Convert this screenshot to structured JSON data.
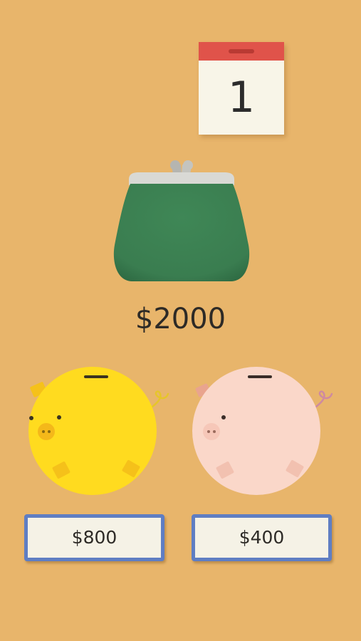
{
  "calendar": {
    "day": "1",
    "icon": "calendar-icon",
    "colors": {
      "header": "#e0534a",
      "page": "#f8f5e8"
    }
  },
  "wallet": {
    "icon": "coin-purse-icon",
    "amount": "$2000",
    "colors": {
      "body": "#3f8756",
      "clasp": "#d6d6d2"
    }
  },
  "piggy_banks": [
    {
      "icon": "yellow-piggy-bank-icon",
      "color": "#ffdb1f",
      "button_label": "$800"
    },
    {
      "icon": "pink-piggy-bank-icon",
      "color": "#fad7c9",
      "button_label": "$400"
    }
  ],
  "colors": {
    "background": "#e8b56b",
    "button_border": "#5f7ec3",
    "button_face": "#f5f2e6"
  }
}
